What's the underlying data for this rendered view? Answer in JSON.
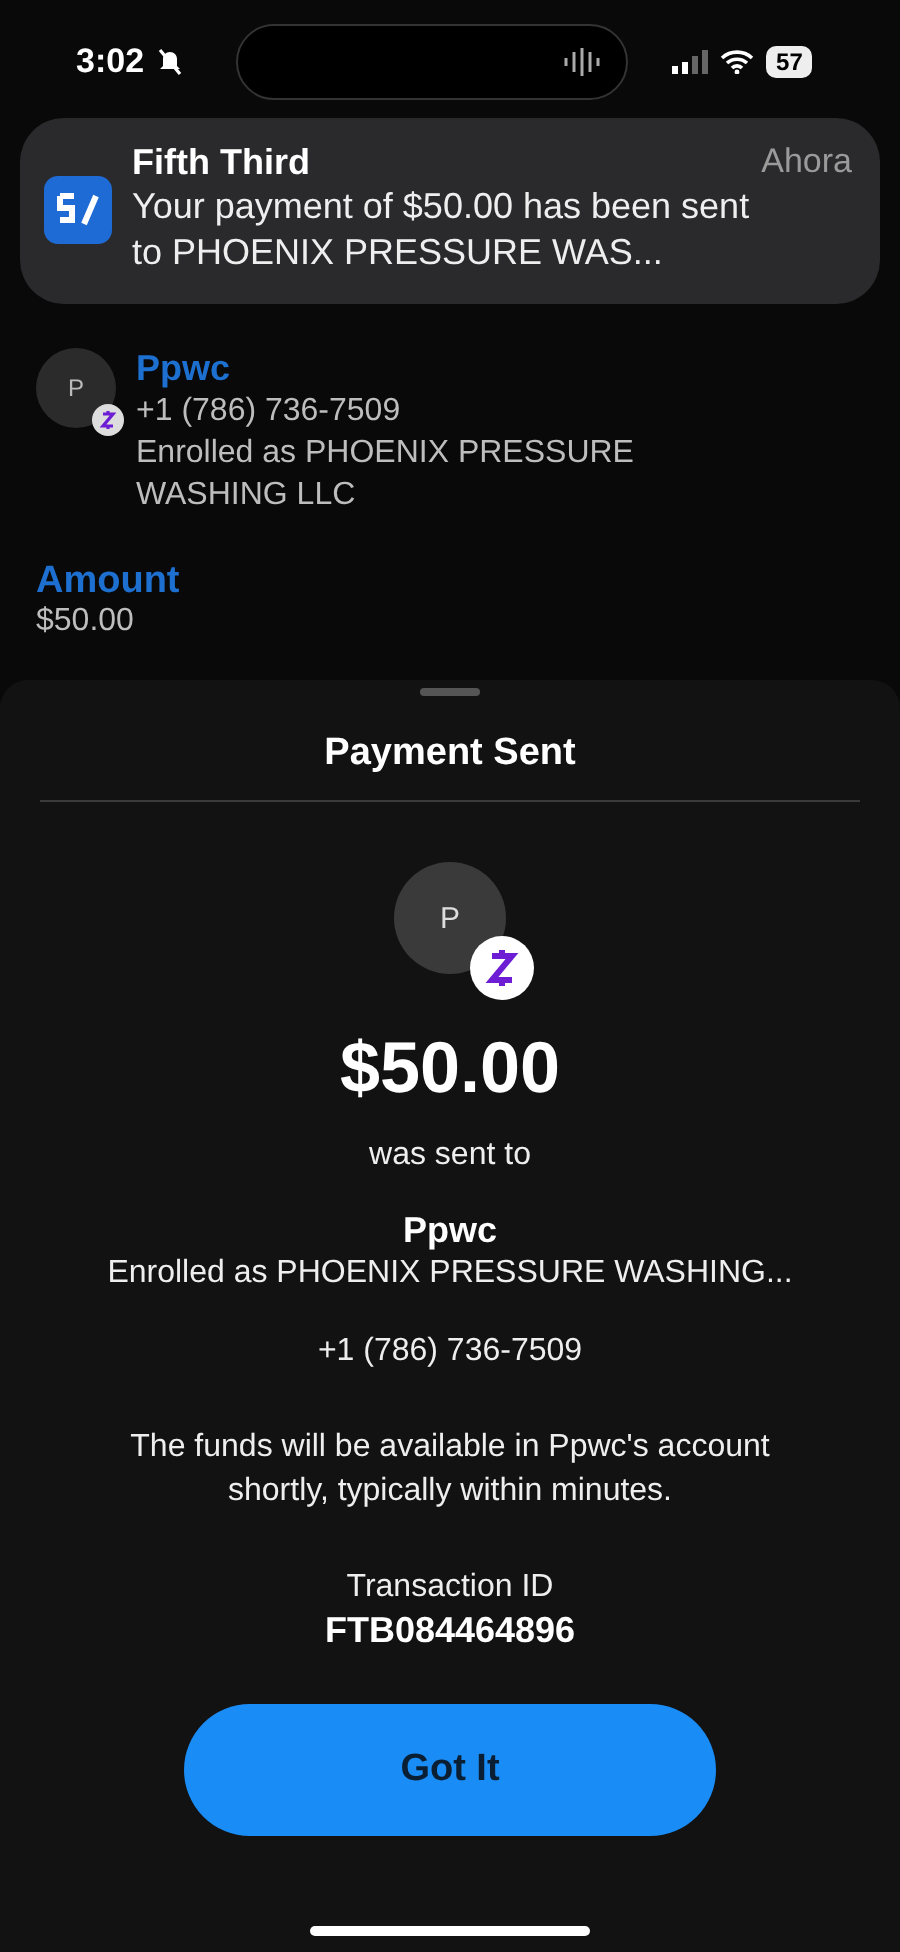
{
  "status_bar": {
    "time": "3:02",
    "battery": "57"
  },
  "notification": {
    "app": "Fifth Third",
    "time": "Ahora",
    "message": "Your payment of $50.00 has been sent to PHOENIX PRESSURE WAS..."
  },
  "contact": {
    "initial": "P",
    "name": "Ppwc",
    "phone": "+1 (786) 736-7509",
    "enrolled": "Enrolled as PHOENIX PRESSURE WASHING LLC"
  },
  "amount": {
    "label": "Amount",
    "value": "$50.00"
  },
  "sheet": {
    "title": "Payment Sent",
    "initial": "P",
    "amount": "$50.00",
    "sent_to": "was sent to",
    "name": "Ppwc",
    "enrolled": "Enrolled as PHOENIX PRESSURE WASHING...",
    "phone": "+1 (786) 736-7509",
    "note": "The funds will be available in Ppwc's account shortly, typically within minutes.",
    "transaction_label": "Transaction ID",
    "transaction_id": "FTB084464896",
    "button": "Got It"
  }
}
